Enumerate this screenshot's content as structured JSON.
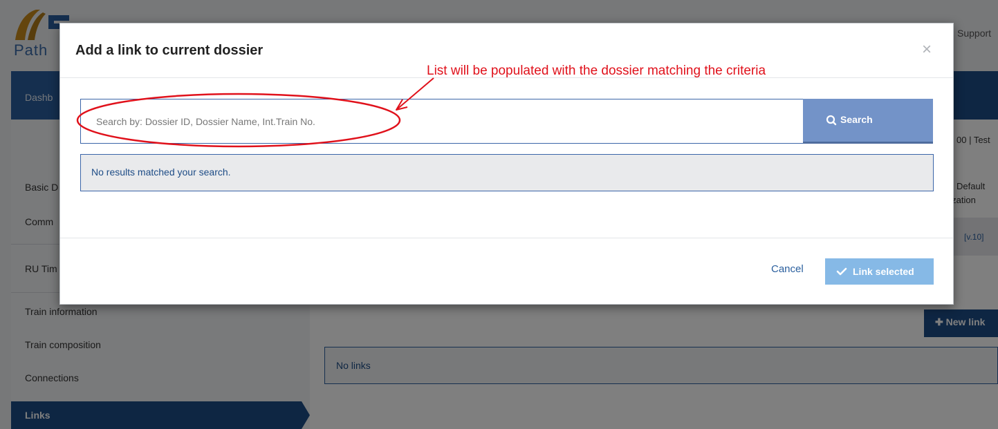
{
  "header": {
    "logo_subtitle": "Path",
    "support_link": "Support"
  },
  "nav": {
    "dashboard": "Dashb"
  },
  "sidebar": {
    "items": [
      {
        "label": "Basic D"
      },
      {
        "label": "Comm"
      },
      {
        "label": "RU Tim"
      },
      {
        "label": "Train information"
      },
      {
        "label": "Train composition"
      },
      {
        "label": "Connections"
      },
      {
        "label": "Links"
      }
    ]
  },
  "main": {
    "right_info_1": "00 | Test",
    "right_info_2": "Default",
    "right_info_3": "nization",
    "version": "[v.10]",
    "new_link_button": "New link",
    "no_links": "No links"
  },
  "modal": {
    "title": "Add a link to current dossier",
    "close": "×",
    "search": {
      "placeholder": "Search by: Dossier ID, Dossier Name, Int.Train No.",
      "value": "",
      "button_label": "Search"
    },
    "results_message": "No results matched your search.",
    "cancel_label": "Cancel",
    "link_selected_label": "Link selected"
  },
  "annotation": {
    "text": "List will be populated with the dossier matching the criteria",
    "color": "#e0111b"
  },
  "colors": {
    "brand_navy": "#1d4c86",
    "search_button": "#7393c8",
    "primary_button_disabled": "#86b9e6",
    "logo_gold": "#c98a1a"
  }
}
